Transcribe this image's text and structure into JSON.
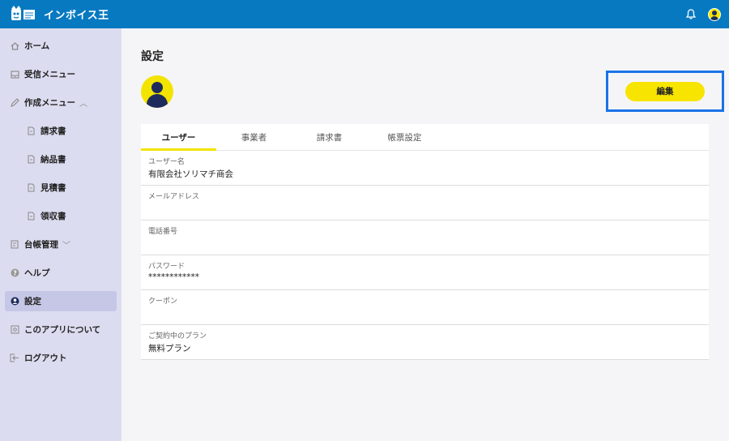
{
  "app": {
    "name": "インボイス王"
  },
  "header": {
    "bell_icon": "bell-icon",
    "avatar_icon": "user-avatar-icon"
  },
  "sidebar": {
    "items": [
      {
        "label": "ホーム",
        "icon": "home-icon"
      },
      {
        "label": "受信メニュー",
        "icon": "inbox-icon"
      },
      {
        "label": "作成メニュー",
        "icon": "pencil-icon",
        "expanded": true
      },
      {
        "label": "請求書",
        "icon": "document-icon"
      },
      {
        "label": "納品書",
        "icon": "document-icon"
      },
      {
        "label": "見積書",
        "icon": "document-icon"
      },
      {
        "label": "領収書",
        "icon": "document-icon"
      },
      {
        "label": "台帳管理",
        "icon": "ledger-icon",
        "expanded": false
      },
      {
        "label": "ヘルプ",
        "icon": "help-icon"
      },
      {
        "label": "設定",
        "icon": "user-circle-icon",
        "active": true
      },
      {
        "label": "このアプリについて",
        "icon": "info-icon"
      },
      {
        "label": "ログアウト",
        "icon": "logout-icon"
      }
    ]
  },
  "main": {
    "title": "設定",
    "edit_label": "編集",
    "tabs": [
      {
        "label": "ユーザー",
        "active": true
      },
      {
        "label": "事業者"
      },
      {
        "label": "請求書"
      },
      {
        "label": "帳票設定"
      }
    ],
    "fields": [
      {
        "label": "ユーザー名",
        "value": "有限会社ソリマチ商会"
      },
      {
        "label": "メールアドレス",
        "value": ""
      },
      {
        "label": "電話番号",
        "value": ""
      },
      {
        "label": "パスワード",
        "value": "************"
      },
      {
        "label": "クーポン",
        "value": ""
      },
      {
        "label": "ご契約中のプラン",
        "value": "無料プラン"
      }
    ]
  },
  "colors": {
    "header": "#0779c1",
    "sidebar": "#dcdcf0",
    "accent": "#f3e400",
    "highlight": "#1a73e8"
  }
}
